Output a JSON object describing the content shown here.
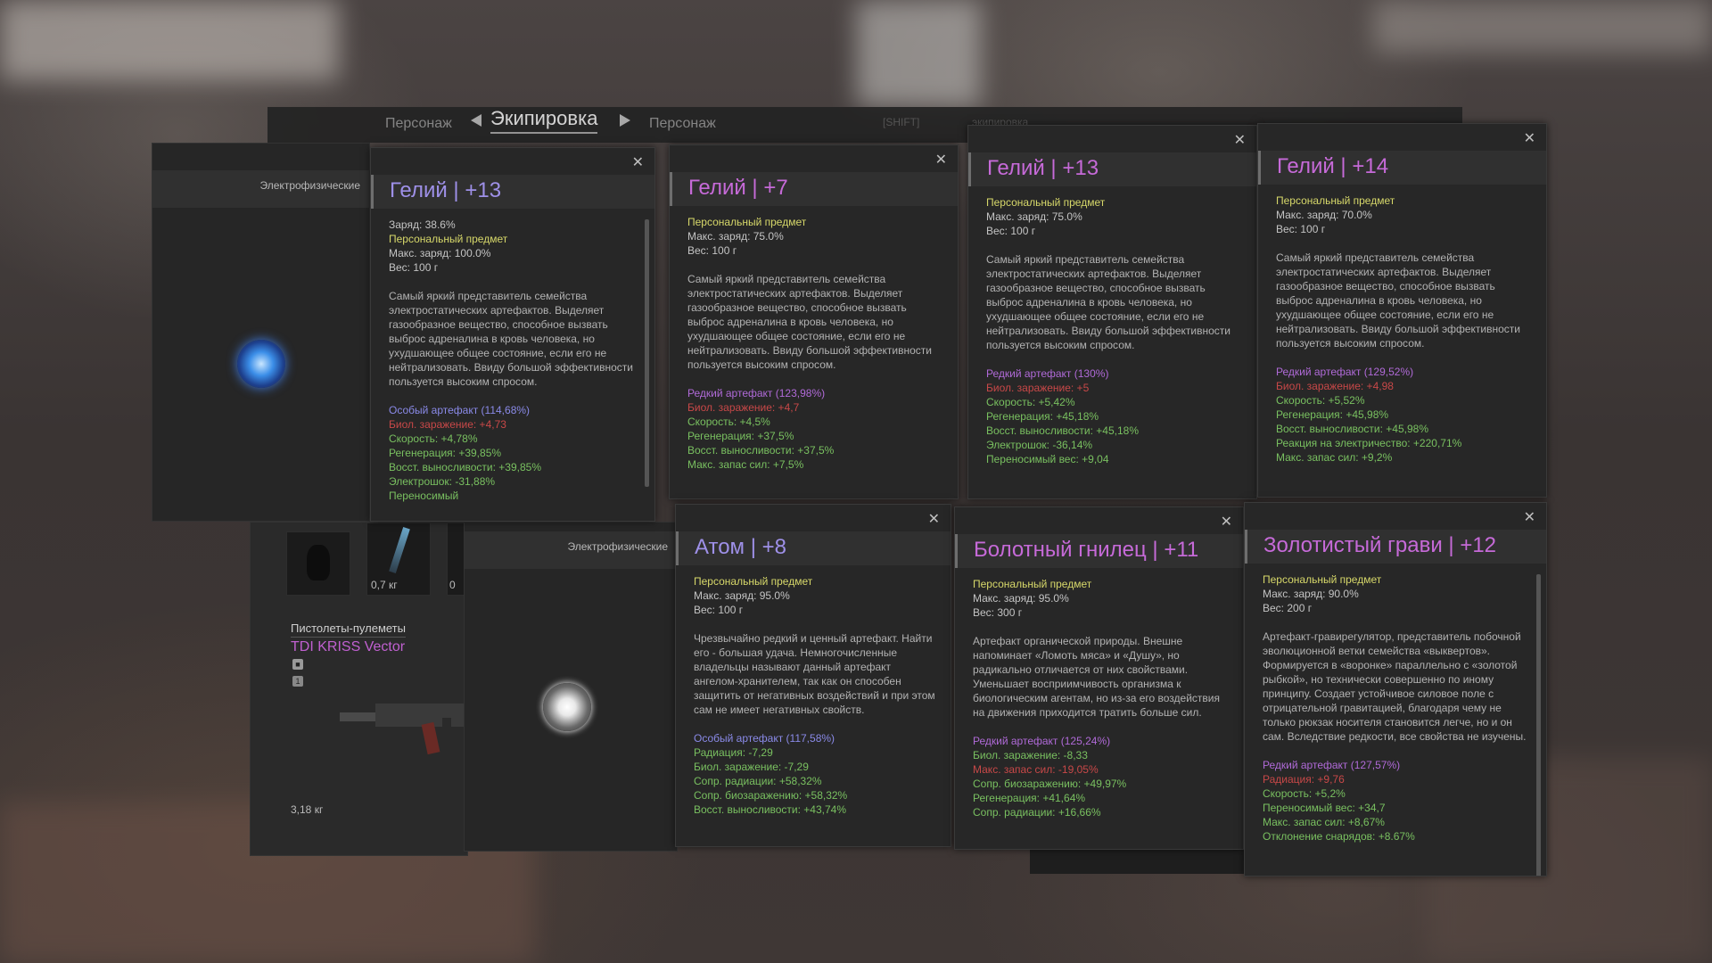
{
  "header": {
    "nav_left": "Персонаж",
    "nav_active": "Экипировка",
    "nav_right": "Персонаж",
    "faded_1": "[SHIFT]",
    "faded_2": "экипировка"
  },
  "left_panel": {
    "category": "Электрофизические"
  },
  "mid_panel": {
    "category": "Электрофизические"
  },
  "inventory": {
    "slot_weight": "0,7 кг",
    "slot_extra": "0",
    "weapon_category": "Пистолеты-пулеметы",
    "weapon_name": "TDI KRISS Vector",
    "badge_number": "1",
    "weapon_weight": "3,18 кг"
  },
  "cards": [
    {
      "name": "Гелий",
      "level": "+13",
      "title_color": "#9e90e8",
      "base": [
        "Заряд: 38.6%"
      ],
      "personal": "Персональный предмет",
      "charge": "Макс. заряд: 100.0%",
      "weight": "Вес: 100 г",
      "description": "Самый яркий представитель семейства электростатических артефактов. Выделяет газообразное вещество, способное вызвать выброс адреналина в кровь человека, но ухудшающее общее состояние, если его не нейтрализовать. Ввиду большой эффективности пользуется высоким спросом.",
      "rarity": "Особый артефакт (114,68%)",
      "rarity_color": "#8a8ae8",
      "stats": [
        {
          "text": "Биол. заражение: +4,73",
          "color": "#c84848"
        },
        {
          "text": "Скорость: +4,78%",
          "color": "#79c060"
        },
        {
          "text": "Регенерация: +39,85%",
          "color": "#79c060"
        },
        {
          "text": "Восст. выносливости: +39,85%",
          "color": "#79c060"
        },
        {
          "text": "Электрошок: -31,88%",
          "color": "#79c060"
        },
        {
          "text": "Переносимый",
          "color": "#79c060"
        }
      ]
    },
    {
      "name": "Гелий",
      "level": "+7",
      "title_color": "#c66ad8",
      "base": [],
      "personal": "Персональный предмет",
      "charge": "Макс. заряд: 75.0%",
      "weight": "Вес: 100 г",
      "description": "Самый яркий представитель семейства электростатических артефактов. Выделяет газообразное вещество, способное вызвать выброс адреналина в кровь человека, но ухудшающее общее состояние, если его не нейтрализовать. Ввиду большой эффективности пользуется высоким спросом.",
      "rarity": "Редкий артефакт (123,98%)",
      "rarity_color": "#b06ad8",
      "stats": [
        {
          "text": "Биол. заражение: +4,7",
          "color": "#c84848"
        },
        {
          "text": "Скорость: +4,5%",
          "color": "#79c060"
        },
        {
          "text": "Регенерация: +37,5%",
          "color": "#79c060"
        },
        {
          "text": "Восст. выносливости: +37,5%",
          "color": "#79c060"
        },
        {
          "text": "Макс. запас сил: +7,5%",
          "color": "#79c060"
        }
      ]
    },
    {
      "name": "Гелий",
      "level": "+13",
      "title_color": "#c66ad8",
      "base": [],
      "personal": "Персональный предмет",
      "charge": "Макс. заряд: 75.0%",
      "weight": "Вес: 100 г",
      "description": "Самый яркий представитель семейства электростатических артефактов. Выделяет газообразное вещество, способное вызвать выброс адреналина в кровь человека, но ухудшающее общее состояние, если его не нейтрализовать. Ввиду большой эффективности пользуется высоким спросом.",
      "rarity": "Редкий артефакт (130%)",
      "rarity_color": "#b06ad8",
      "stats": [
        {
          "text": "Биол. заражение: +5",
          "color": "#c84848"
        },
        {
          "text": "Скорость: +5,42%",
          "color": "#79c060"
        },
        {
          "text": "Регенерация: +45,18%",
          "color": "#79c060"
        },
        {
          "text": "Восст. выносливости: +45,18%",
          "color": "#79c060"
        },
        {
          "text": "Электрошок: -36,14%",
          "color": "#79c060"
        },
        {
          "text": "Переносимый вес: +9,04",
          "color": "#79c060"
        }
      ]
    },
    {
      "name": "Гелий",
      "level": "+14",
      "title_color": "#c66ad8",
      "base": [],
      "personal": "Персональный предмет",
      "charge": "Макс. заряд: 70.0%",
      "weight": "Вес: 100 г",
      "description": "Самый яркий представитель семейства электростатических артефактов. Выделяет газообразное вещество, способное вызвать выброс адреналина в кровь человека, но ухудшающее общее состояние, если его не нейтрализовать. Ввиду большой эффективности пользуется высоким спросом.",
      "rarity": "Редкий артефакт (129,52%)",
      "rarity_color": "#b06ad8",
      "stats": [
        {
          "text": "Биол. заражение: +4,98",
          "color": "#c84848"
        },
        {
          "text": "Скорость: +5,52%",
          "color": "#79c060"
        },
        {
          "text": "Регенерация: +45,98%",
          "color": "#79c060"
        },
        {
          "text": "Восст. выносливости: +45,98%",
          "color": "#79c060"
        },
        {
          "text": "Реакция на электричество: +220,71%",
          "color": "#79c060"
        },
        {
          "text": "Макс. запас сил: +9,2%",
          "color": "#79c060"
        }
      ]
    },
    {
      "name": "Атом",
      "level": "+8",
      "title_color": "#9e90e8",
      "base": [],
      "personal": "Персональный предмет",
      "charge": "Макс. заряд: 95.0%",
      "weight": "Вес: 100 г",
      "description": "Чрезвычайно редкий и ценный артефакт. Найти его - большая удача. Немногочисленные владельцы называют данный артефакт ангелом-хранителем, так как он способен защитить от негативных воздействий и при этом сам не имеет негативных свойств.",
      "rarity": "Особый артефакт (117,58%)",
      "rarity_color": "#8a8ae8",
      "stats": [
        {
          "text": "Радиация: -7,29",
          "color": "#79c060"
        },
        {
          "text": "Биол. заражение: -7,29",
          "color": "#79c060"
        },
        {
          "text": "Сопр. радиации: +58,32%",
          "color": "#79c060"
        },
        {
          "text": "Сопр. биозаражению: +58,32%",
          "color": "#79c060"
        },
        {
          "text": "Восст. выносливости: +43,74%",
          "color": "#79c060"
        }
      ]
    },
    {
      "name": "Болотный гнилец",
      "level": "+11",
      "title_color": "#c66ad8",
      "base": [],
      "personal": "Персональный предмет",
      "charge": "Макс. заряд: 95.0%",
      "weight": "Вес: 300 г",
      "description": "Артефакт органической природы. Внешне напоминает «Ломоть мяса» и «Душу», но радикально отличается от них свойствами. Уменьшает восприимчивость организма к биологическим агентам, но из-за его воздействия на движения приходится тратить больше сил.",
      "rarity": "Редкий артефакт (125,24%)",
      "rarity_color": "#b06ad8",
      "stats": [
        {
          "text": "Биол. заражение: -8,33",
          "color": "#79c060"
        },
        {
          "text": "Макс. запас сил: -19,05%",
          "color": "#c84848"
        },
        {
          "text": "Сопр. биозаражению: +49,97%",
          "color": "#79c060"
        },
        {
          "text": "Регенерация: +41,64%",
          "color": "#79c060"
        },
        {
          "text": "Сопр. радиации: +16,66%",
          "color": "#79c060"
        }
      ]
    },
    {
      "name": "Золотистый грави",
      "level": "+12",
      "title_color": "#c66ad8",
      "base": [],
      "personal": "Персональный предмет",
      "charge": "Макс. заряд: 90.0%",
      "weight": "Вес: 200 г",
      "description": "Артефакт-гравирегулятор, представитель побочной эволюционной ветки семейства «выквертов». Формируется в «воронке» параллельно с «золотой рыбкой», но технически совершенно по иному принципу. Создает устойчивое силовое поле с отрицательной гравитацией, благодаря чему не только рюкзак носителя становится легче, но и он сам. Вследствие редкости, все свойства не изучены.",
      "rarity": "Редкий артефакт (127,57%)",
      "rarity_color": "#b06ad8",
      "stats": [
        {
          "text": "Радиация: +9,76",
          "color": "#c84848"
        },
        {
          "text": "Скорость: +5,2%",
          "color": "#79c060"
        },
        {
          "text": "Переносимый вес: +34,7",
          "color": "#79c060"
        },
        {
          "text": "Макс. запас сил: +8,67%",
          "color": "#79c060"
        },
        {
          "text": "Отклонение снарядов: +8.67%",
          "color": "#79c060"
        }
      ]
    }
  ]
}
